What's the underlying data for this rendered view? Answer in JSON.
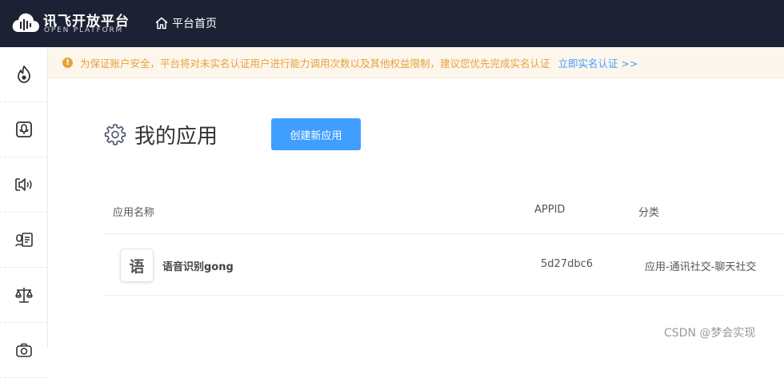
{
  "header": {
    "logo_title": "讯飞开放平台",
    "logo_subtitle": "OPEN PLATFORM",
    "home_label": "平台首页",
    "home_icon": "home-icon"
  },
  "sidebar": {
    "items": [
      {
        "icon": "flame-icon"
      },
      {
        "icon": "voice-recognition-icon"
      },
      {
        "icon": "speaker-icon"
      },
      {
        "icon": "document-voice-icon"
      },
      {
        "icon": "scale-icon"
      },
      {
        "icon": "camera-icon"
      }
    ]
  },
  "notice": {
    "icon": "warning-icon",
    "text": "为保证账户安全，平台将对未实名认证用户进行能力调用次数以及其他权益限制，建议您优先完成实名认证",
    "link": "立即实名认证 >>"
  },
  "page": {
    "title": "我的应用",
    "title_icon": "gear-icon",
    "create_button": "创建新应用"
  },
  "table": {
    "columns": [
      "应用名称",
      "APPID",
      "分类"
    ],
    "rows": [
      {
        "icon_char": "语",
        "name": "语音识别gong",
        "appid": "5d27dbc6",
        "category": "应用-通讯社交-聊天社交"
      }
    ]
  },
  "watermark": "CSDN @梦会实现",
  "colors": {
    "topbar": "#1c2133",
    "accent": "#409eff",
    "warning": "#e6a23c",
    "notice_bg": "#fdf6ec"
  }
}
